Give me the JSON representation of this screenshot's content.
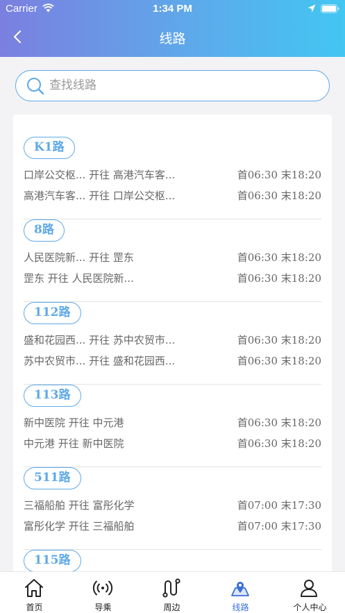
{
  "status_bar": {
    "carrier": "Carrier",
    "time": "1:34 PM"
  },
  "header": {
    "title": "线路"
  },
  "search": {
    "placeholder": "查找线路"
  },
  "routes": [
    {
      "name": "K1路",
      "lines": [
        {
          "direction": "口岸公交枢... 开往 高港汽车客...",
          "time": "首06:30 末18:20"
        },
        {
          "direction": "高港汽车客... 开往 口岸公交枢...",
          "time": "首06:30 末18:20"
        }
      ]
    },
    {
      "name": "8路",
      "lines": [
        {
          "direction": "人民医院新... 开往 罡东",
          "time": "首06:30 末18:20"
        },
        {
          "direction": "罡东 开往 人民医院新...",
          "time": "首06:30 末18:20"
        }
      ]
    },
    {
      "name": "112路",
      "lines": [
        {
          "direction": "盛和花园西... 开往 苏中农贸市...",
          "time": "首06:30 末18:20"
        },
        {
          "direction": "苏中农贸市... 开往 盛和花园西...",
          "time": "首06:30 末18:20"
        }
      ]
    },
    {
      "name": "113路",
      "lines": [
        {
          "direction": "新中医院 开往 中元港",
          "time": "首06:30 末18:20"
        },
        {
          "direction": "中元港 开往 新中医院",
          "time": "首06:30 末18:20"
        }
      ]
    },
    {
      "name": "511路",
      "lines": [
        {
          "direction": "三福船舶 开往 富彤化学",
          "time": "首07:00 末17:30"
        },
        {
          "direction": "富彤化学 开往 三福船舶",
          "time": "首07:00 末17:30"
        }
      ]
    },
    {
      "name": "115路",
      "lines": []
    }
  ],
  "tabbar": {
    "items": [
      {
        "label": "首页",
        "icon": "home-icon"
      },
      {
        "label": "导乘",
        "icon": "broadcast-icon"
      },
      {
        "label": "周边",
        "icon": "route-path-icon"
      },
      {
        "label": "线路",
        "icon": "map-pin-icon",
        "active": true
      },
      {
        "label": "个人中心",
        "icon": "user-icon"
      }
    ]
  },
  "colors": {
    "accent": "#5ea9ea",
    "header_start": "#7b7fe0",
    "header_end": "#42c6f2",
    "tab_active": "#3a6fd8"
  }
}
